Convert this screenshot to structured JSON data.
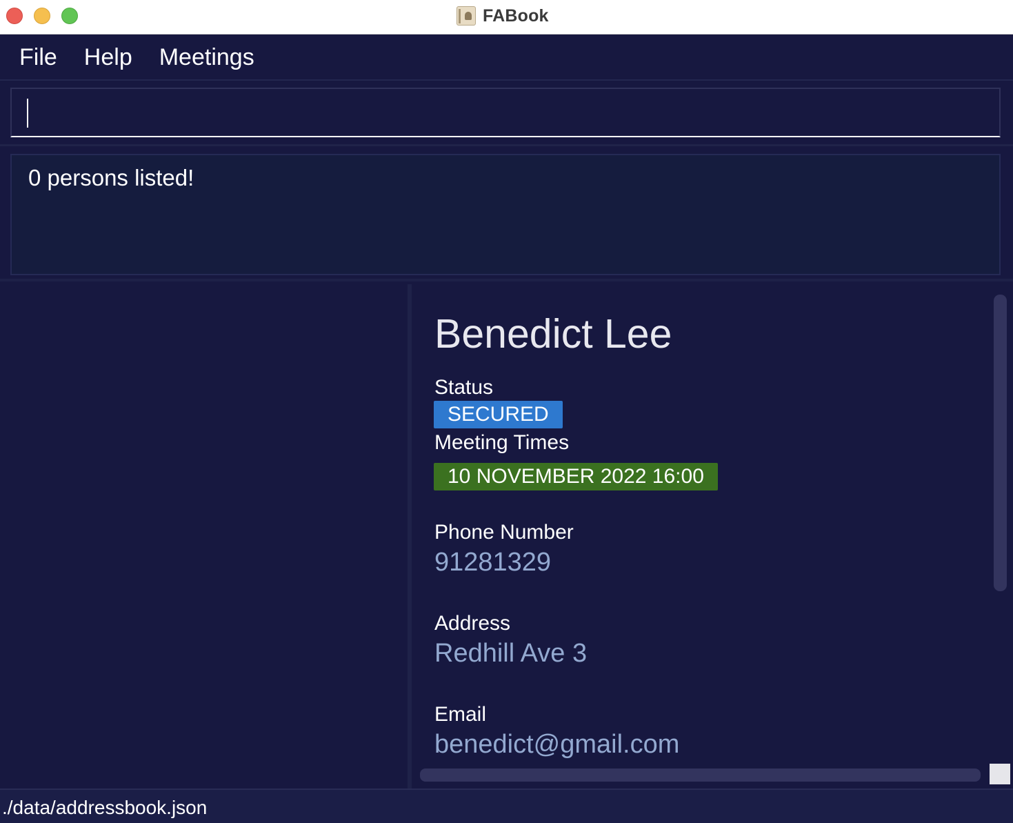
{
  "window": {
    "title": "FABook",
    "app_icon": "address-book-icon"
  },
  "menu": {
    "items": [
      "File",
      "Help",
      "Meetings"
    ]
  },
  "command": {
    "value": "",
    "placeholder": ""
  },
  "result": {
    "message": "0 persons listed!"
  },
  "person": {
    "name": "Benedict Lee",
    "status_label": "Status",
    "status": "SECURED",
    "meeting_label": "Meeting Times",
    "meeting_time": "10 NOVEMBER 2022 16:00",
    "phone_label": "Phone Number",
    "phone": "91281329",
    "address_label": "Address",
    "address": "Redhill Ave 3",
    "email_label": "Email",
    "email": "benedict@gmail.com"
  },
  "status_bar": {
    "path": "./data/addressbook.json"
  },
  "colors": {
    "background": "#171840",
    "status_badge": "#2e79cf",
    "meeting_badge": "#3b7120",
    "value_text": "#93a9d0"
  }
}
